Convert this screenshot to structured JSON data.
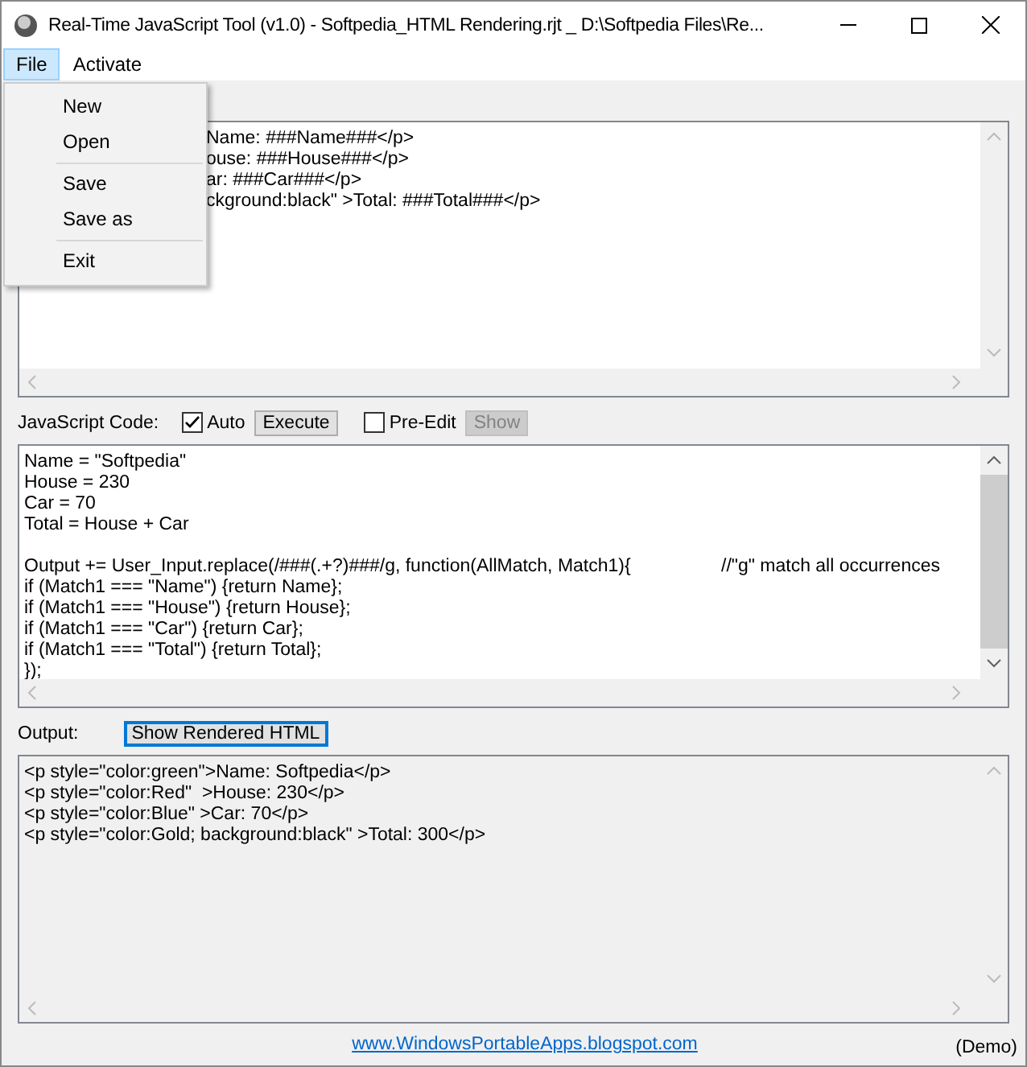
{
  "window": {
    "title": "Real-Time JavaScript Tool (v1.0) - Softpedia_HTML Rendering.rjt _ D:\\Softpedia Files\\Re..."
  },
  "menu": [
    {
      "label": "File",
      "selected": true
    },
    {
      "label": "Activate",
      "selected": false
    }
  ],
  "file_menu": [
    [
      "New",
      "Open"
    ],
    [
      "Save",
      "Save as"
    ],
    [
      "Exit"
    ]
  ],
  "html_template": {
    "lines": [
      "Name: ###Name###</p>",
      "ouse: ###House###</p>",
      "ar: ###Car###</p>",
      "ckground:black\" >Total: ###Total###</p>"
    ]
  },
  "javascript_bar": {
    "label": "JavaScript Code:",
    "auto": {
      "label": "Auto",
      "checked": true
    },
    "execute": {
      "label": "Execute",
      "disabled": false
    },
    "pre_edit": {
      "label": "Pre-Edit",
      "checked": false
    },
    "show": {
      "label": "Show",
      "disabled": true
    }
  },
  "code": [
    [
      {
        "text": "Name = \"Softpedia\""
      },
      {
        "text": "House = 230"
      },
      {
        "text": "Car = 70"
      },
      {
        "text": "Total = House + Car"
      }
    ],
    [
      {
        "text": "Output += User_Input.replace(/###(.+?)###/g, function(AllMatch, Match1){",
        "comment": "//\"g\" match all occurrences"
      },
      {
        "text": "if (Match1 === \"Name\") {return Name};"
      },
      {
        "text": "if (Match1 === \"House\") {return House};"
      },
      {
        "text": "if (Match1 === \"Car\") {return Car};"
      },
      {
        "text": "if (Match1 === \"Total\") {return Total};"
      },
      {
        "text": "});"
      }
    ]
  ],
  "output_bar": {
    "label": "Output:",
    "button": {
      "label": "Show Rendered HTML",
      "focused": true
    }
  },
  "output": [
    "<p style=\"color:green\">Name: Softpedia</p>",
    "<p style=\"color:Red\"  >House: 230</p>",
    "<p style=\"color:Blue\" >Car: 70</p>",
    "<p style=\"color:Gold; background:black\" >Total: 300</p>"
  ],
  "footer": {
    "link": "www.WindowsPortableApps.blogspot.com",
    "note": "(Demo)"
  }
}
